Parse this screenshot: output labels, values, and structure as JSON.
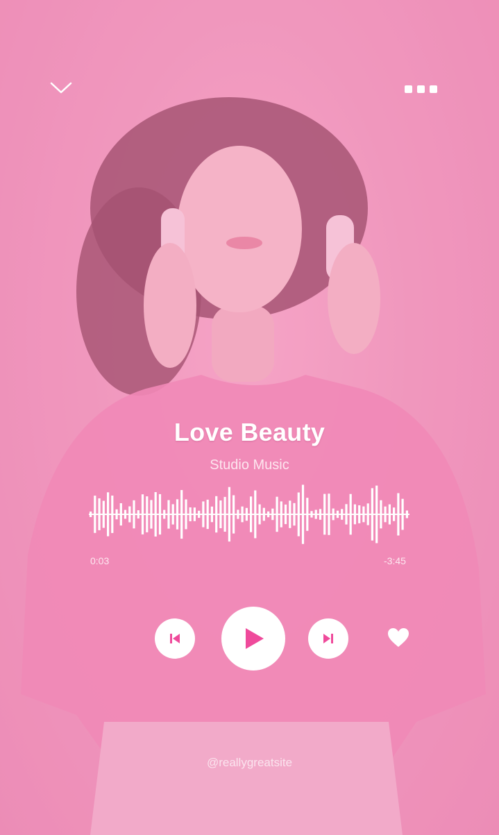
{
  "player": {
    "title": "Love Beauty",
    "artist": "Studio Music",
    "elapsed": "0:03",
    "remaining": "-3:45",
    "progress_fraction": 0.013,
    "liked": true
  },
  "footer": {
    "handle": "@reallygreatsite"
  },
  "icons": {
    "collapse": "chevron-down-icon",
    "more": "more-dots-icon",
    "prev": "skip-previous-icon",
    "play": "play-icon",
    "next": "skip-next-icon",
    "like": "heart-icon"
  },
  "colors": {
    "background": "#ef96bb",
    "accent": "#ef4a9b",
    "text": "#ffffff"
  }
}
